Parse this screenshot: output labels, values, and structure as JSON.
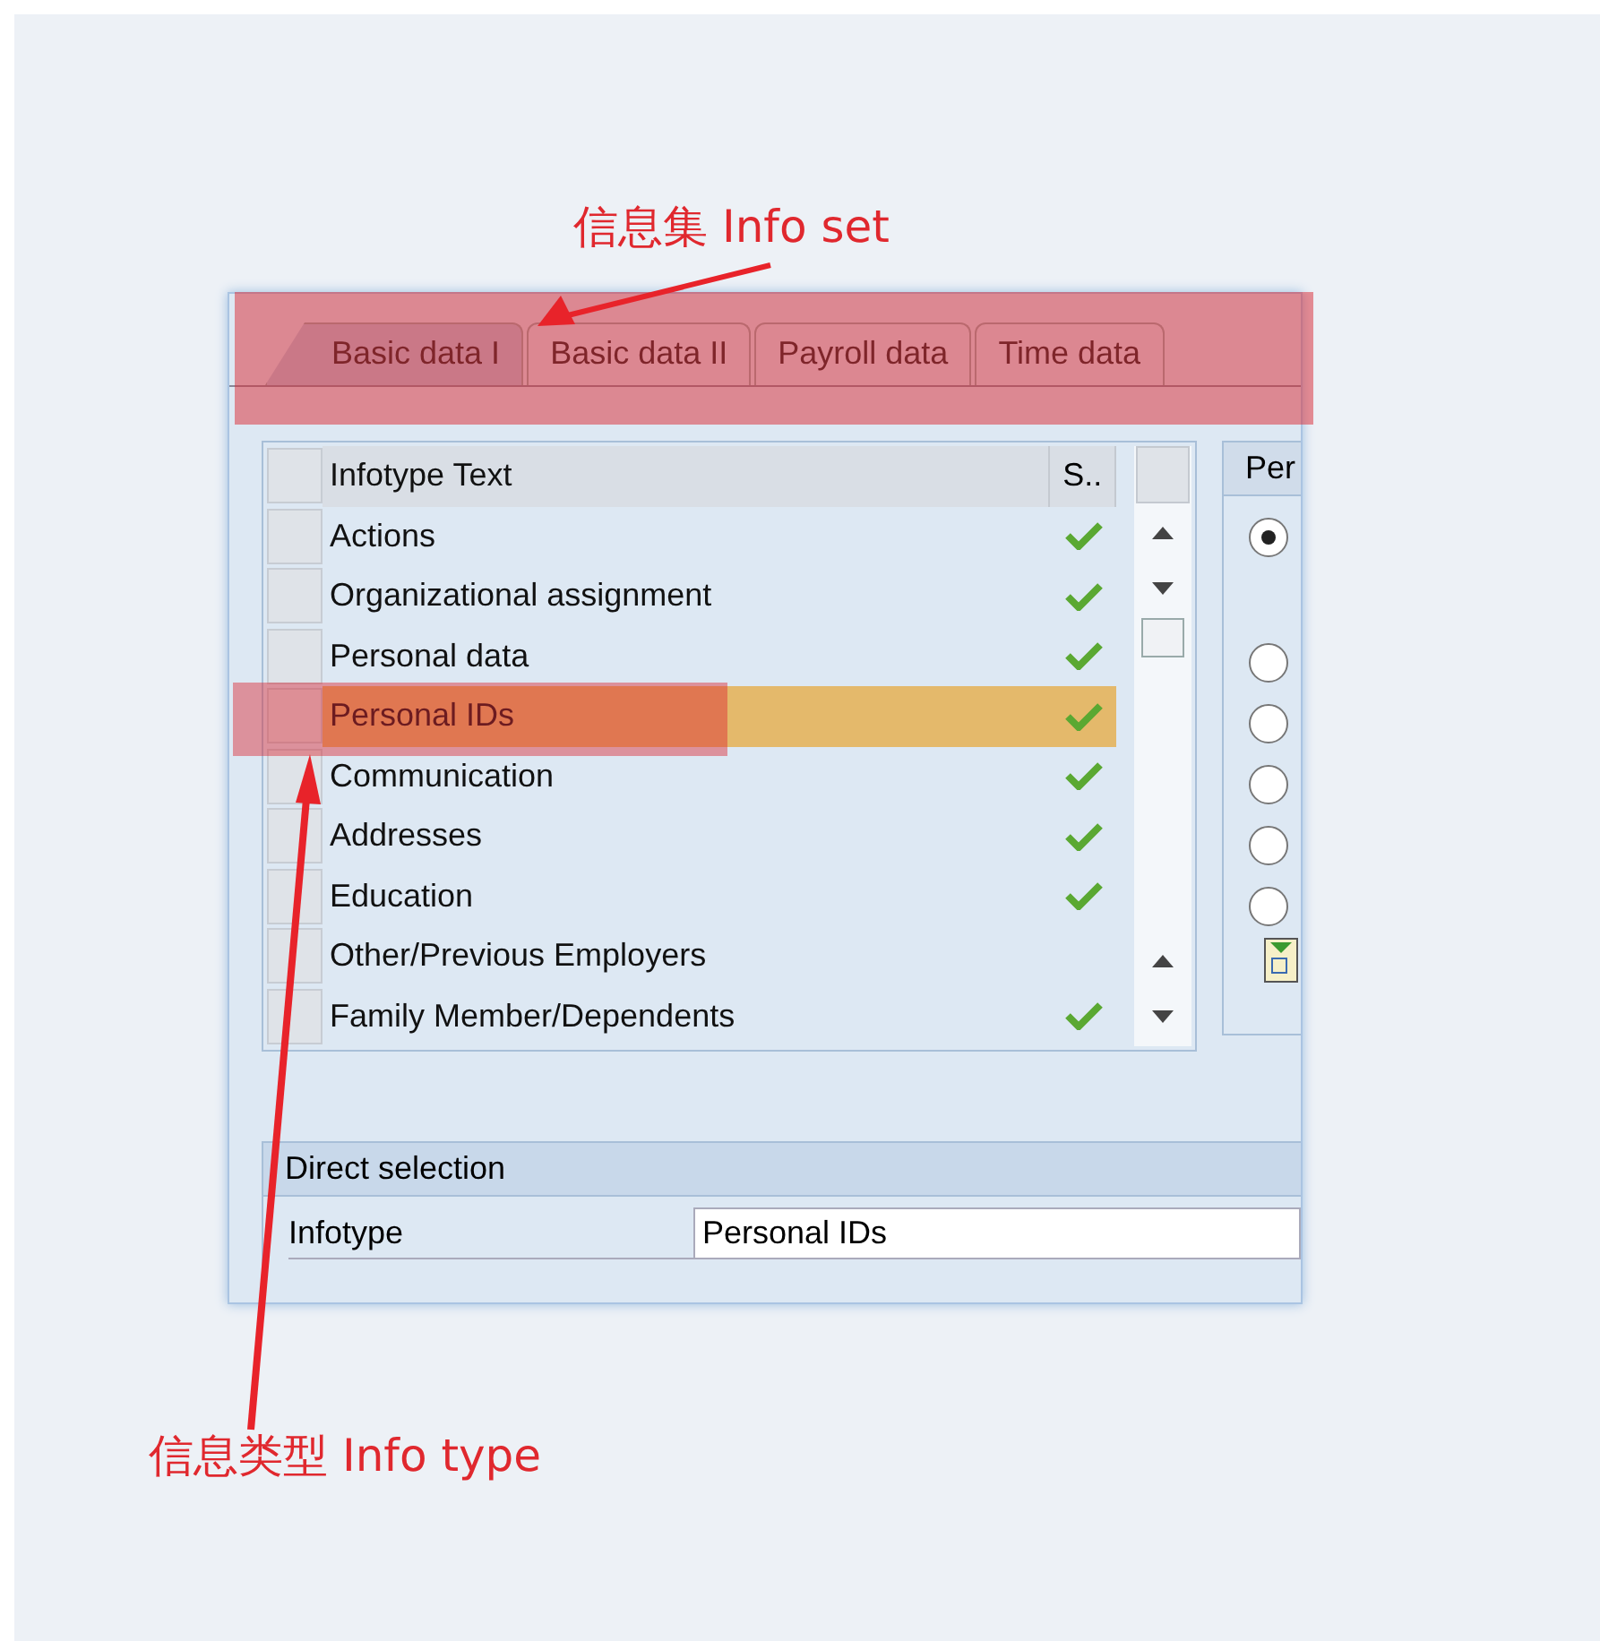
{
  "annotations": [
    {
      "text": "信息集 Info set"
    },
    {
      "text": "信息类型 Info type"
    }
  ],
  "tabs": [
    {
      "label": "Basic data I",
      "selected": true
    },
    {
      "label": "Basic data II",
      "selected": false
    },
    {
      "label": "Payroll data",
      "selected": false
    },
    {
      "label": "Time data",
      "selected": false
    }
  ],
  "table": {
    "columns": [
      "Infotype Text",
      "S.."
    ],
    "rows": [
      {
        "text": "Actions",
        "checked": true,
        "selected": false
      },
      {
        "text": "Organizational assignment",
        "checked": true,
        "selected": false
      },
      {
        "text": "Personal data",
        "checked": true,
        "selected": false
      },
      {
        "text": "Personal IDs",
        "checked": true,
        "selected": true
      },
      {
        "text": "Communication",
        "checked": true,
        "selected": false
      },
      {
        "text": "Addresses",
        "checked": true,
        "selected": false
      },
      {
        "text": "Education",
        "checked": true,
        "selected": false
      },
      {
        "text": "Other/Previous Employers",
        "checked": false,
        "selected": false
      },
      {
        "text": "Family Member/Dependents",
        "checked": true,
        "selected": false
      }
    ]
  },
  "side_group": {
    "title": "Per",
    "radios": [
      {
        "selected": true
      },
      {
        "selected": false
      },
      {
        "selected": false
      },
      {
        "selected": false
      },
      {
        "selected": false
      },
      {
        "selected": false
      }
    ]
  },
  "direct_selection": {
    "title": "Direct selection",
    "label": "Infotype",
    "value": "Personal IDs"
  }
}
